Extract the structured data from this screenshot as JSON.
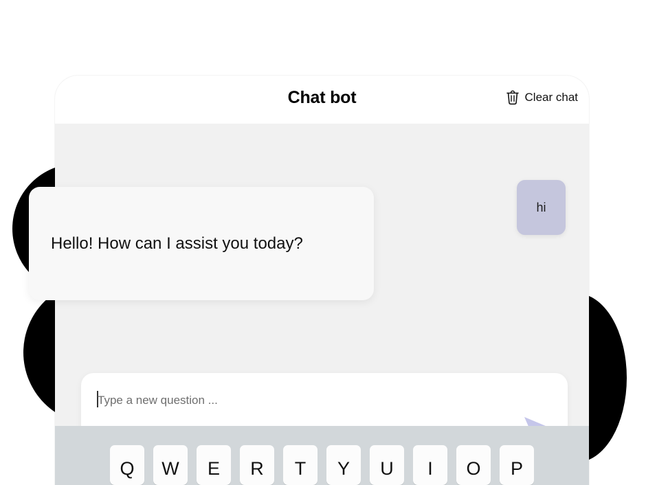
{
  "header": {
    "title": "Chat bot",
    "clear_chat_label": "Clear chat",
    "trash_icon": "trash-icon"
  },
  "messages": [
    {
      "role": "user",
      "text": "hi"
    },
    {
      "role": "bot",
      "text": "Hello! How can I assist you today?"
    }
  ],
  "composer": {
    "placeholder": "Type a new question ...",
    "value": "",
    "send_icon": "send-icon"
  },
  "keyboard": {
    "row1": [
      "Q",
      "W",
      "E",
      "R",
      "T",
      "Y",
      "U",
      "I",
      "O",
      "P"
    ]
  },
  "colors": {
    "user_bubble": "#c5c6dd",
    "bot_bubble": "#f8f8f8",
    "send_arrow": "#c5c6ea",
    "chat_background": "#f1f1f1",
    "keyboard_background": "#d2d7da",
    "key_face": "#fcfcfc",
    "blob": "#000000"
  }
}
